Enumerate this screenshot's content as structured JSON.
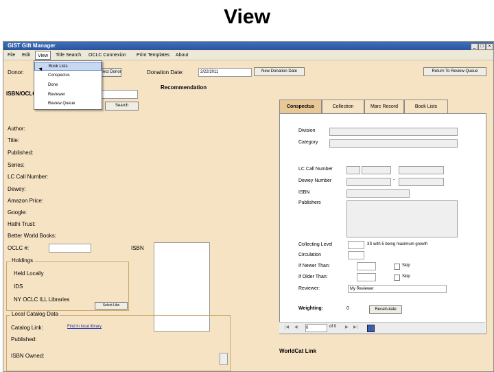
{
  "slide_title": "View",
  "window": {
    "title": "GIST Gift Manager",
    "buttons": [
      "_",
      "□",
      "×"
    ]
  },
  "menu": [
    "File",
    "Edit",
    "View",
    "Title Search",
    "OCLC Connexion",
    "Print Templates",
    "About"
  ],
  "view_menu": [
    "Book Lists",
    "Conspectus",
    "Done",
    "Reviewer",
    "Review Queue"
  ],
  "donor": {
    "label": "Donor:",
    "select_donor_btn": "Select Donor"
  },
  "donation_date": {
    "label": "Donation Date:",
    "value": "2/22/2011",
    "new_btn": "New Donation Date"
  },
  "return_btn": "Return To Review Queue",
  "isbn_oclc_label": "ISBN/OCLC",
  "recommendation_label": "Recommendation",
  "search_btn": "Search",
  "fields": [
    "Author:",
    "Title:",
    "Published:",
    "Series:",
    "LC Call Number:",
    "Dewey:",
    "Amazon Price:",
    "Google:",
    "Hathi Trust:",
    "Better World Books:"
  ],
  "oclc_label": "OCLC #:",
  "isbn_label": "ISBN",
  "holdings": {
    "title": "Holdings",
    "items": [
      "Held Locally",
      "IDS",
      "NY OCLC ILL Libraries"
    ],
    "btn": "Select Libs"
  },
  "local_catalog": {
    "title": "Local Catalog Data",
    "catalog_link_label": "Catalog Link:",
    "catalog_link_value": "Find in local library",
    "published": "Published:",
    "isbn_owned": "ISBN Owned:"
  },
  "tabs": [
    "Conspectus",
    "Collection",
    "Marc Record",
    "Book Lists"
  ],
  "conspectus": {
    "division": "Division",
    "category": "Category",
    "lc_call": "LC Call Number",
    "dewey": "Dewey Number",
    "isbn": "ISBN",
    "publishers": "Publishers",
    "collecting_level": "Collecting Level",
    "collecting_level_note": "3S with 5 being maximum growth",
    "circulation": "Circulation",
    "if_newer": "If Newer Than:",
    "if_older": "If Older Than:",
    "reviewer": "Reviewer:",
    "reviewer_value": "My Reviewer",
    "skip": "Skip",
    "weighting": "Weighting:",
    "weighting_value": "0",
    "recalculate": "Recalculate",
    "nav_page": "0",
    "nav_of": "of 0"
  },
  "worldcat_label": "WorldCat Link"
}
